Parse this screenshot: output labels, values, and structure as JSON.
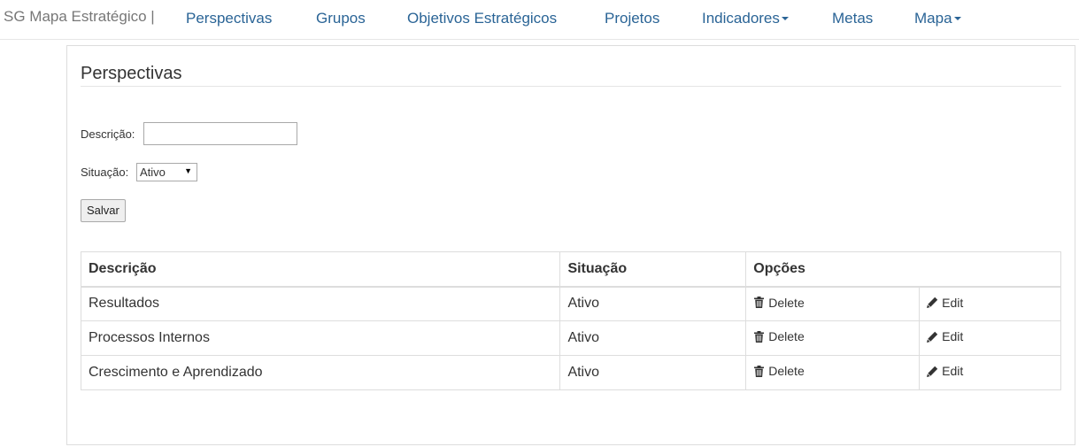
{
  "navbar": {
    "brand": "SG Mapa Estratégico |",
    "links": [
      {
        "label": "Perspectivas"
      },
      {
        "label": "Grupos"
      },
      {
        "label": "Objetivos Estratégicos"
      },
      {
        "label": "Projetos"
      },
      {
        "label": "Indicadores"
      },
      {
        "label": "Metas"
      },
      {
        "label": "Mapa"
      }
    ]
  },
  "page": {
    "title": "Perspectivas"
  },
  "form": {
    "descricao_label": "Descrição:",
    "descricao_value": "",
    "situacao_label": "Situação:",
    "situacao_selected": "Ativo",
    "save_label": "Salvar"
  },
  "table": {
    "headers": [
      "Descrição",
      "Situação",
      "Opções"
    ],
    "delete_label": "Delete",
    "edit_label": "Edit",
    "rows": [
      {
        "descricao": "Resultados",
        "situacao": "Ativo"
      },
      {
        "descricao": "Processos Internos",
        "situacao": "Ativo"
      },
      {
        "descricao": "Crescimento e Aprendizado",
        "situacao": "Ativo"
      }
    ]
  },
  "icons": {
    "dropdown": "caret-down-icon",
    "delete": "trash-icon",
    "edit": "pencil-icon"
  },
  "colors": {
    "link": "#2a6496",
    "brand": "#777777",
    "border": "#dddddd"
  }
}
